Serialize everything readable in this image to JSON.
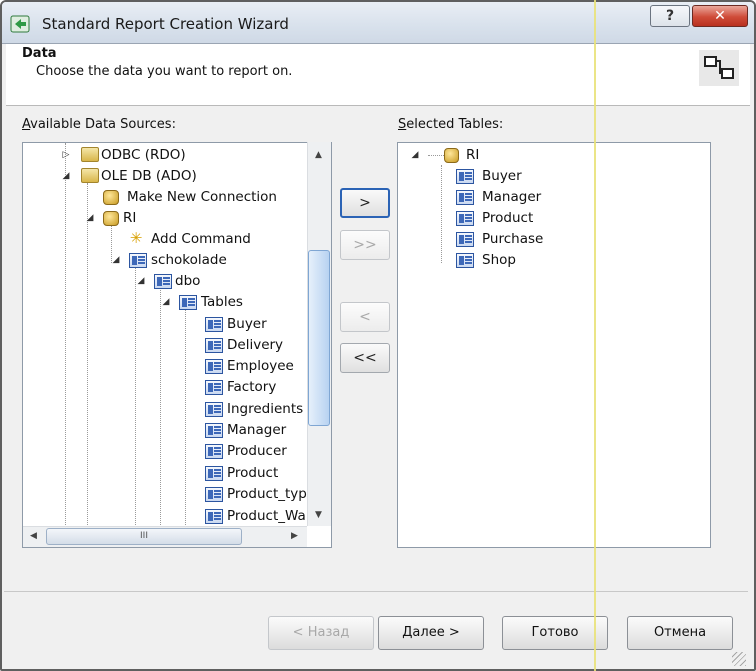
{
  "window": {
    "title": "Standard Report Creation Wizard",
    "help_label": "?",
    "close_label": "✕"
  },
  "header": {
    "title": "Data",
    "subtitle": "Choose the data you want to report on."
  },
  "available": {
    "label_prefix": "A",
    "label_rest": "vailable Data Sources:",
    "tree": [
      {
        "text": "ODBC (RDO)",
        "icon": "folder-icon",
        "expander": "▷"
      },
      {
        "text": "OLE DB (ADO)",
        "icon": "folder-icon",
        "expander": "◢"
      },
      {
        "text": "Make New Connection",
        "icon": "new-connection-icon",
        "expander": ""
      },
      {
        "text": "RI",
        "icon": "database-icon",
        "expander": "◢"
      },
      {
        "text": "Add Command",
        "icon": "add-command-icon",
        "expander": ""
      },
      {
        "text": "schokolade",
        "icon": "table-icon",
        "expander": "◢"
      },
      {
        "text": "dbo",
        "icon": "table-icon",
        "expander": "◢"
      },
      {
        "text": "Tables",
        "icon": "table-icon",
        "expander": "◢"
      },
      {
        "text": "Buyer",
        "icon": "table-icon",
        "expander": ""
      },
      {
        "text": "Delivery",
        "icon": "table-icon",
        "expander": ""
      },
      {
        "text": "Employee",
        "icon": "table-icon",
        "expander": ""
      },
      {
        "text": "Factory",
        "icon": "table-icon",
        "expander": ""
      },
      {
        "text": "Ingredients",
        "icon": "table-icon",
        "expander": ""
      },
      {
        "text": "Manager",
        "icon": "table-icon",
        "expander": ""
      },
      {
        "text": "Producer",
        "icon": "table-icon",
        "expander": ""
      },
      {
        "text": "Product",
        "icon": "table-icon",
        "expander": ""
      },
      {
        "text": "Product_typ",
        "icon": "table-icon",
        "expander": ""
      },
      {
        "text": "Product_Wa",
        "icon": "table-icon",
        "expander": ""
      }
    ],
    "hscroll_grip": "III"
  },
  "selected": {
    "label_prefix": "S",
    "label_rest": "elected Tables:",
    "tree": [
      {
        "text": "RI",
        "icon": "database-icon",
        "expander": "◢"
      },
      {
        "text": "Buyer",
        "icon": "table-icon"
      },
      {
        "text": "Manager",
        "icon": "table-icon"
      },
      {
        "text": "Product",
        "icon": "table-icon"
      },
      {
        "text": "Purchase",
        "icon": "table-icon"
      },
      {
        "text": "Shop",
        "icon": "table-icon"
      }
    ]
  },
  "move_buttons": {
    "add_one": ">",
    "add_all": ">>",
    "remove_one": "<",
    "remove_all": "<<"
  },
  "footer": {
    "back": "< Назад",
    "next_prefix": "Д",
    "next_rest": "алее >",
    "finish": "Готово",
    "cancel": "Отмена"
  }
}
